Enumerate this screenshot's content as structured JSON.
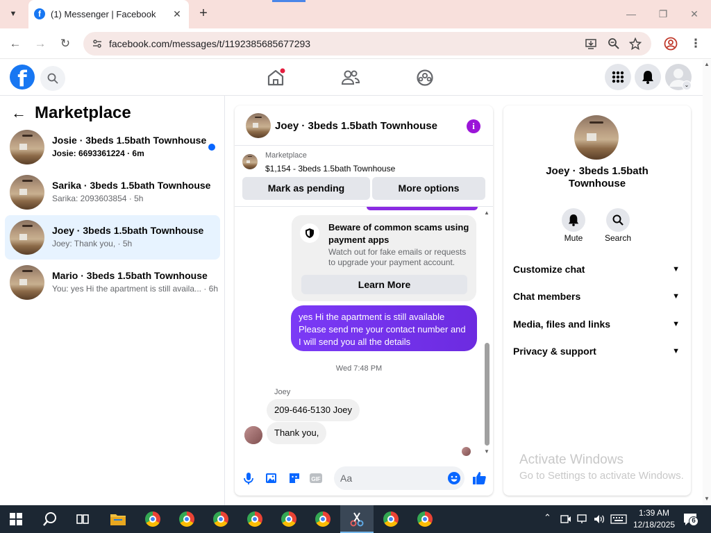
{
  "browser": {
    "tab_title": "(1) Messenger | Facebook",
    "tab_close": "✕",
    "new_tab": "+",
    "url": "facebook.com/messages/t/1192385685677293"
  },
  "facebook": {
    "logo": "f",
    "nav_icons": [
      "home-icon",
      "friends-icon",
      "groups-icon"
    ],
    "right_icons": [
      "menu-grid-icon",
      "notifications-icon",
      "account-icon"
    ]
  },
  "sidebar": {
    "title": "Marketplace",
    "conversations": [
      {
        "name": "Josie · 3beds 1.5bath Townhouse",
        "preview": "Josie: 6693361224 · 6m",
        "unread": true,
        "active": false
      },
      {
        "name": "Sarika · 3beds 1.5bath Townhouse",
        "preview": "Sarika: 2093603854 · 5h",
        "unread": false,
        "active": false
      },
      {
        "name": "Joey · 3beds 1.5bath Townhouse",
        "preview": "Joey: Thank you, · 5h",
        "unread": false,
        "active": true
      },
      {
        "name": "Mario · 3beds 1.5bath Townhouse",
        "preview": "You: yes Hi the apartment is still availa... · 6h",
        "unread": false,
        "active": false
      }
    ]
  },
  "chat": {
    "title": "Joey · 3beds 1.5bath Townhouse",
    "listing_source": "Marketplace",
    "listing_desc": "$1,154 - 3beds 1.5bath Townhouse",
    "btn_pending": "Mark as pending",
    "btn_more": "More options",
    "scam_title": "Beware of common scams using payment apps",
    "scam_text": "Watch out for fake emails or requests to upgrade your payment account.",
    "learn_more": "Learn More",
    "sent_message": "yes Hi the apartment is still available Please send me your contact number and I will send you all the details",
    "timestamp": "Wed 7:48 PM",
    "sender": "Joey",
    "received": [
      "209-646-5130 Joey",
      "Thank you,"
    ],
    "input_placeholder": "Aa"
  },
  "info": {
    "name": "Joey · 3beds 1.5bath Townhouse",
    "mute": "Mute",
    "search": "Search",
    "sections": [
      "Customize chat",
      "Chat members",
      "Media, files and links",
      "Privacy & support"
    ]
  },
  "watermark": {
    "line1": "Activate Windows",
    "line2": "Go to Settings to activate Windows."
  },
  "taskbar": {
    "time": "1:39 AM",
    "date": "12/18/2025",
    "notifications": "6"
  }
}
